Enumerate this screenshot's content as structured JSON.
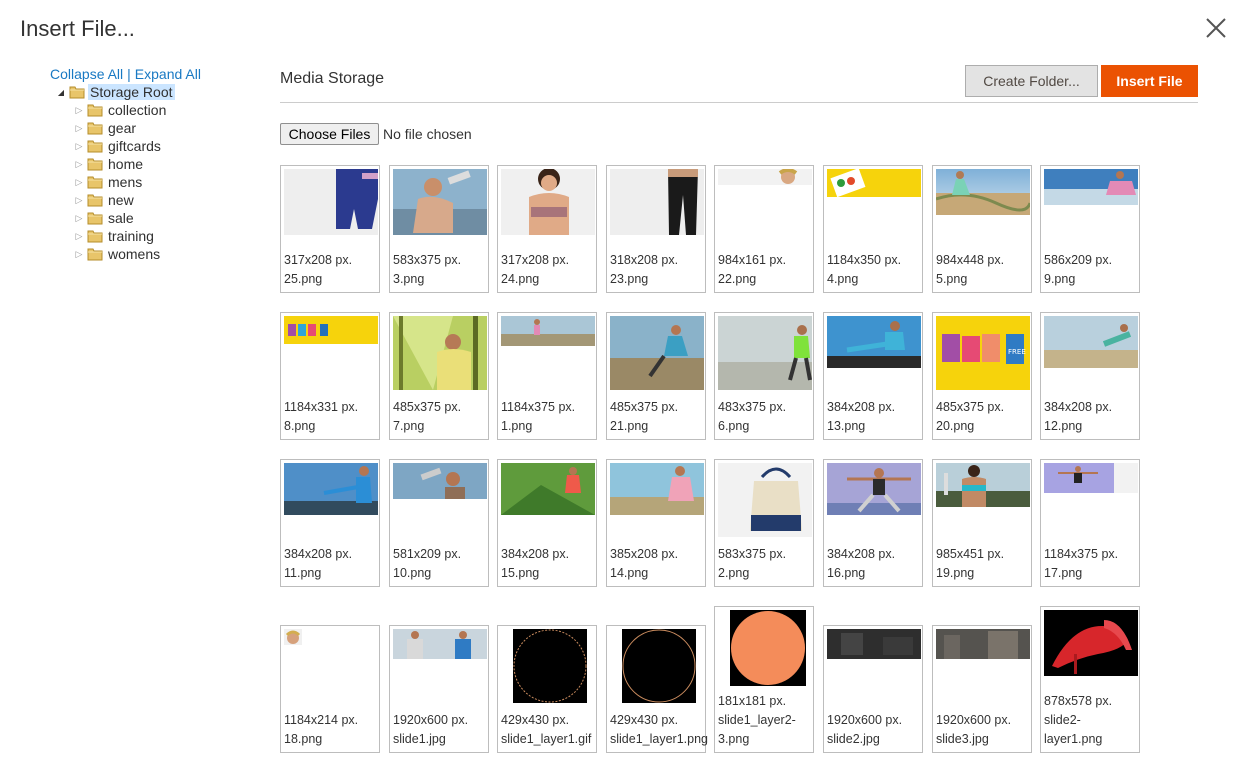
{
  "modal": {
    "title": "Insert File..."
  },
  "tree": {
    "collapse_all": "Collapse All",
    "separator": "|",
    "expand_all": "Expand All",
    "root": "Storage Root",
    "folders": [
      "collection",
      "gear",
      "giftcards",
      "home",
      "mens",
      "new",
      "sale",
      "training",
      "womens"
    ]
  },
  "header": {
    "title": "Media Storage",
    "create_folder": "Create Folder...",
    "insert_file": "Insert File"
  },
  "upload": {
    "button": "Choose Files",
    "status": "No file chosen"
  },
  "colors": {
    "accent": "#eb5202",
    "link": "#1979c3",
    "selected": "#cbe5ff"
  },
  "files": [
    {
      "size": "317x208 px.",
      "name": "25.png"
    },
    {
      "size": "583x375 px.",
      "name": "3.png"
    },
    {
      "size": "317x208 px.",
      "name": "24.png"
    },
    {
      "size": "318x208 px.",
      "name": "23.png"
    },
    {
      "size": "984x161 px.",
      "name": "22.png"
    },
    {
      "size": "1184x350 px.",
      "name": "4.png"
    },
    {
      "size": "984x448 px.",
      "name": "5.png"
    },
    {
      "size": "586x209 px.",
      "name": "9.png"
    },
    {
      "size": "1184x331 px.",
      "name": "8.png"
    },
    {
      "size": "485x375 px.",
      "name": "7.png"
    },
    {
      "size": "1184x375 px.",
      "name": "1.png"
    },
    {
      "size": "485x375 px.",
      "name": "21.png"
    },
    {
      "size": "483x375 px.",
      "name": "6.png"
    },
    {
      "size": "384x208 px.",
      "name": "13.png"
    },
    {
      "size": "485x375 px.",
      "name": "20.png"
    },
    {
      "size": "384x208 px.",
      "name": "12.png"
    },
    {
      "size": "384x208 px.",
      "name": "11.png"
    },
    {
      "size": "581x209 px.",
      "name": "10.png"
    },
    {
      "size": "384x208 px.",
      "name": "15.png"
    },
    {
      "size": "385x208 px.",
      "name": "14.png"
    },
    {
      "size": "583x375 px.",
      "name": "2.png"
    },
    {
      "size": "384x208 px.",
      "name": "16.png"
    },
    {
      "size": "985x451 px.",
      "name": "19.png"
    },
    {
      "size": "1184x375 px.",
      "name": "17.png"
    },
    {
      "size": "1184x214 px.",
      "name": "18.png"
    },
    {
      "size": "1920x600 px.",
      "name": "slide1.jpg"
    },
    {
      "size": "429x430 px.",
      "name": "slide1_layer1.gif"
    },
    {
      "size": "429x430 px.",
      "name": "slide1_layer1.png"
    },
    {
      "size": "181x181 px.",
      "name": "slide1_layer2-",
      "name2": "3.png"
    },
    {
      "size": "1920x600 px.",
      "name": "slide2.jpg"
    },
    {
      "size": "1920x600 px.",
      "name": "slide3.jpg"
    },
    {
      "size": "878x578 px.",
      "name": "slide2-",
      "name2": "layer1.png"
    }
  ]
}
